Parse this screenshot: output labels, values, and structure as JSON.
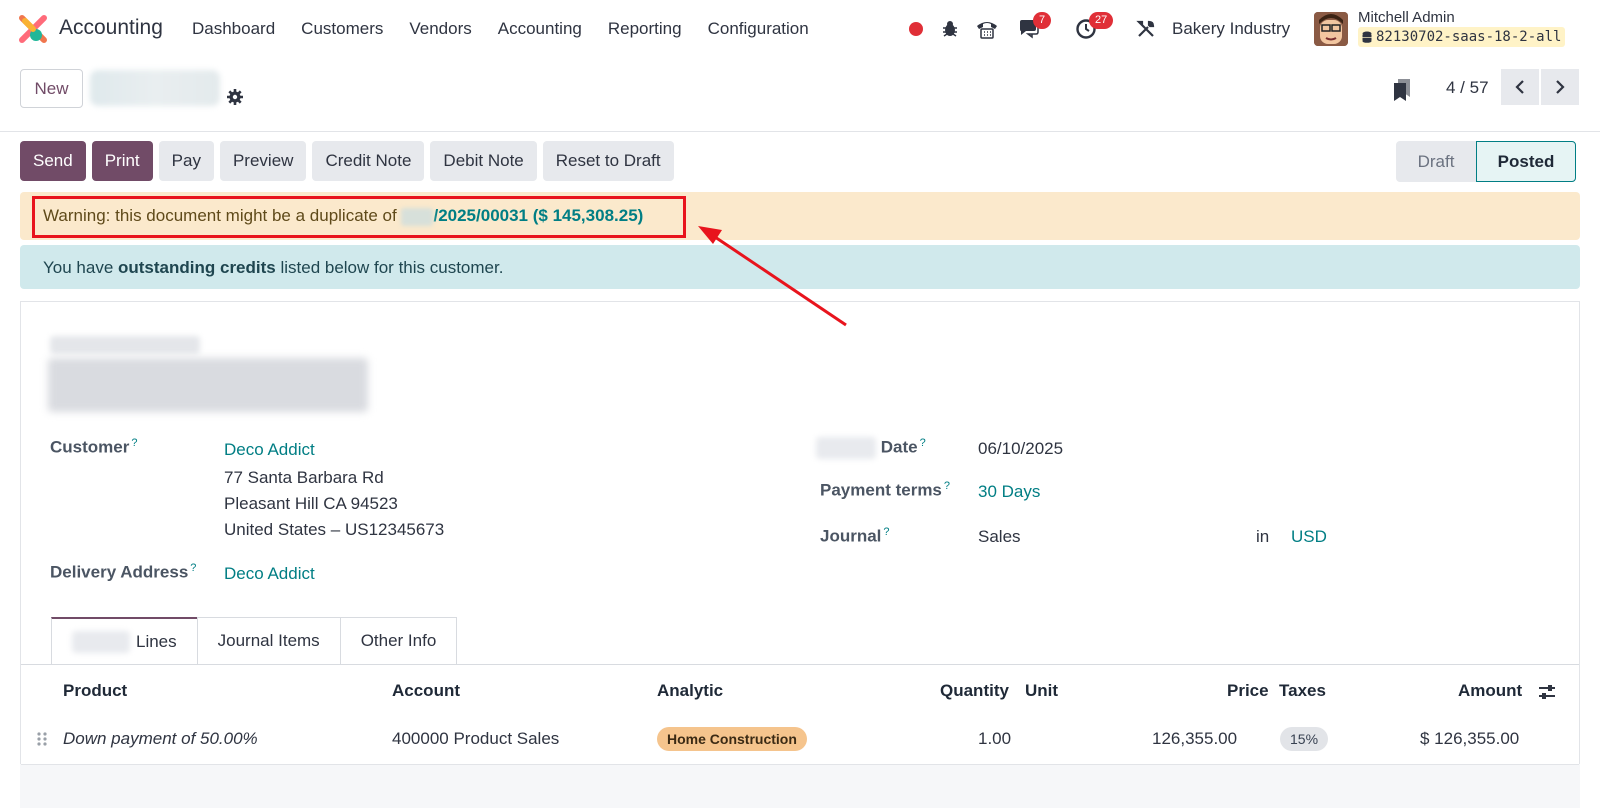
{
  "navbar": {
    "app_name": "Accounting",
    "menu": [
      "Dashboard",
      "Customers",
      "Vendors",
      "Accounting",
      "Reporting",
      "Configuration"
    ],
    "messages_badge": "7",
    "activities_badge": "27",
    "company": "Bakery Industry",
    "user_name": "Mitchell Admin",
    "db_name": "82130702-saas-18-2-all"
  },
  "control_panel": {
    "new_label": "New",
    "pager": "4 / 57"
  },
  "actions": [
    "Send",
    "Print",
    "Pay",
    "Preview",
    "Credit Note",
    "Debit Note",
    "Reset to Draft"
  ],
  "status": {
    "draft": "Draft",
    "posted": "Posted"
  },
  "warning": {
    "prefix": "Warning: this document might be a duplicate of",
    "link": "/2025/00031 ($ 145,308.25)"
  },
  "info": {
    "pre": "You have ",
    "bold": "outstanding credits",
    "post": " listed below for this customer."
  },
  "form": {
    "customer_label": "Customer",
    "customer_value": "Deco Addict",
    "address_line1": "77 Santa Barbara Rd",
    "address_line2": "Pleasant Hill CA 94523",
    "address_line3": "United States – US12345673",
    "delivery_label": "Delivery Address",
    "delivery_value": "Deco Addict",
    "date_label": "Date",
    "date_value": "06/10/2025",
    "payment_terms_label": "Payment terms",
    "payment_terms_value": "30 Days",
    "journal_label": "Journal",
    "journal_value": "Sales",
    "in_label": "in",
    "currency_value": "USD",
    "help_mark": "?"
  },
  "tabs": [
    "Lines",
    "Journal Items",
    "Other Info"
  ],
  "table": {
    "headers": {
      "product": "Product",
      "account": "Account",
      "analytic": "Analytic",
      "quantity": "Quantity",
      "unit": "Unit",
      "price": "Price",
      "taxes": "Taxes",
      "amount": "Amount"
    },
    "row": {
      "product": "Down payment of 50.00%",
      "account": "400000 Product Sales",
      "analytic": "Home Construction",
      "quantity": "1.00",
      "price": "126,355.00",
      "tax": "15%",
      "amount": "$ 126,355.00"
    }
  },
  "colors": {
    "brand": "#714b67",
    "link": "#017e84",
    "warning_bg": "#fbe9cc",
    "info_bg": "#d0e9ec",
    "highlight_red": "#e8141d"
  }
}
